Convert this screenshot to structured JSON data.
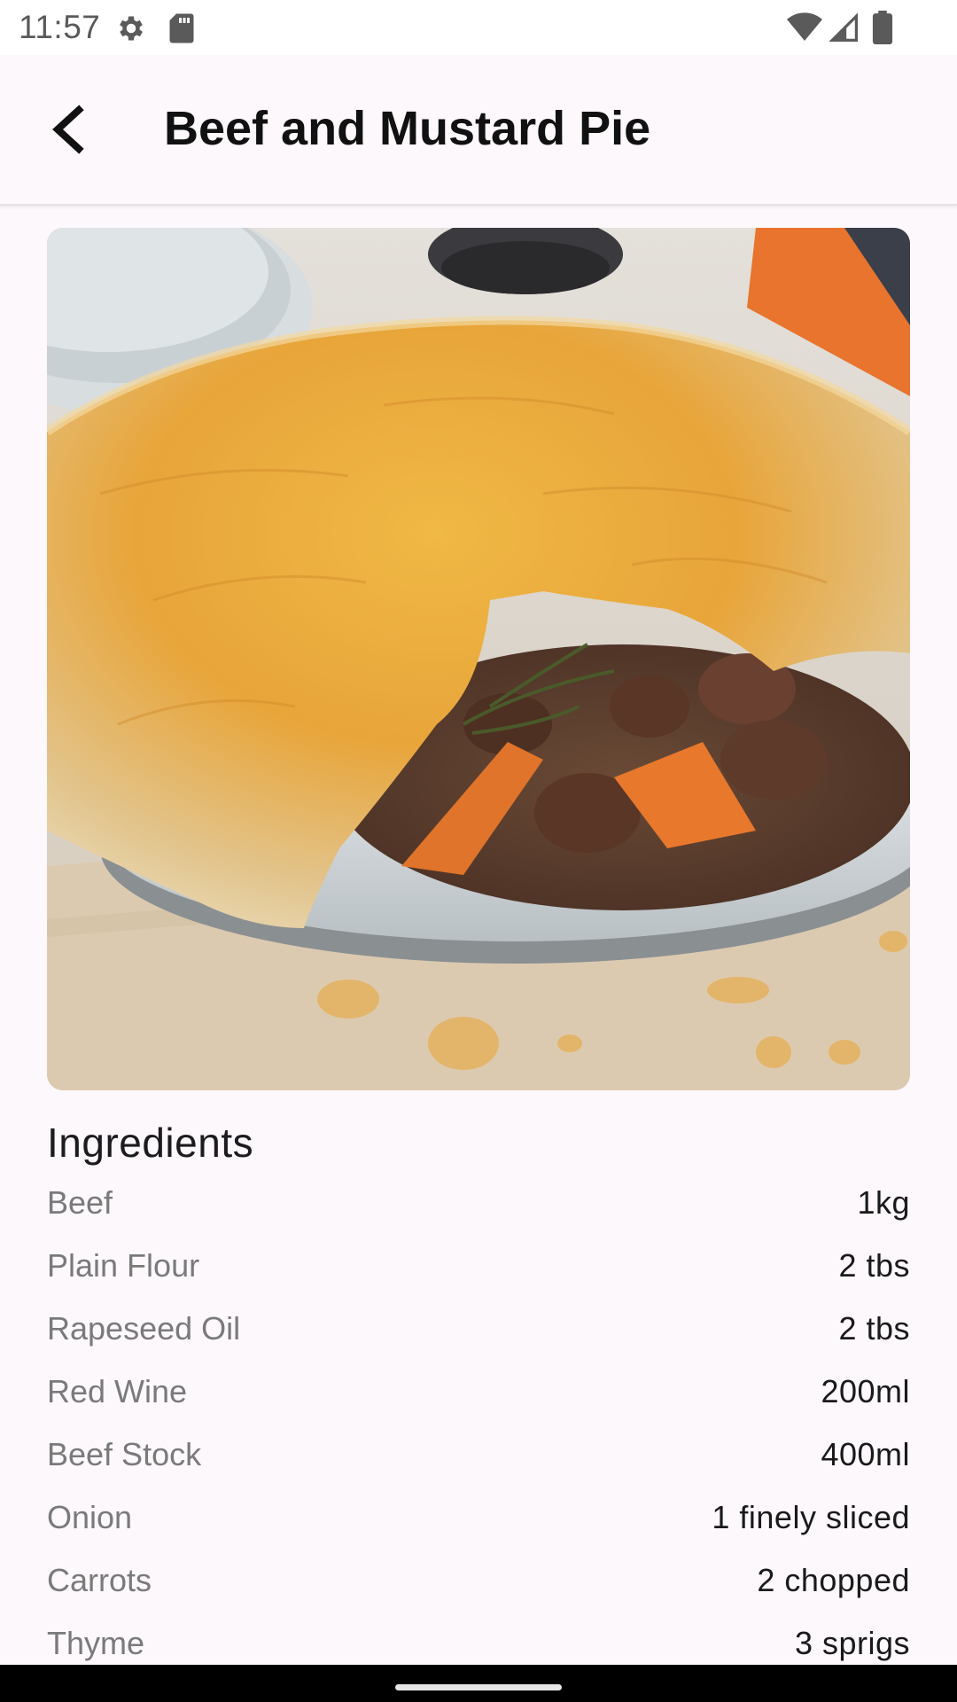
{
  "status_bar": {
    "time": "11:57",
    "icons": [
      "gear-icon",
      "sd-card-icon",
      "wifi-icon",
      "signal-icon",
      "battery-icon"
    ]
  },
  "app_bar": {
    "title": "Beef and Mustard Pie",
    "back_icon": "arrow-back-icon"
  },
  "hero": {
    "alt": "Beef and mustard pie with golden pastry crust, beef chunks and carrots"
  },
  "ingredients": {
    "heading": "Ingredients",
    "items": [
      {
        "name": "Beef",
        "quantity": "1kg"
      },
      {
        "name": "Plain Flour",
        "quantity": "2 tbs"
      },
      {
        "name": "Rapeseed Oil",
        "quantity": "2 tbs"
      },
      {
        "name": "Red Wine",
        "quantity": "200ml"
      },
      {
        "name": "Beef Stock",
        "quantity": "400ml"
      },
      {
        "name": "Onion",
        "quantity": "1 finely sliced"
      },
      {
        "name": "Carrots",
        "quantity": "2 chopped"
      },
      {
        "name": "Thyme",
        "quantity": "3 sprigs"
      }
    ]
  },
  "colors": {
    "background": "#fcf8fc",
    "title": "#111111",
    "ingredient_name": "#7a7a7a",
    "ingredient_quantity": "#1a1a1a"
  }
}
